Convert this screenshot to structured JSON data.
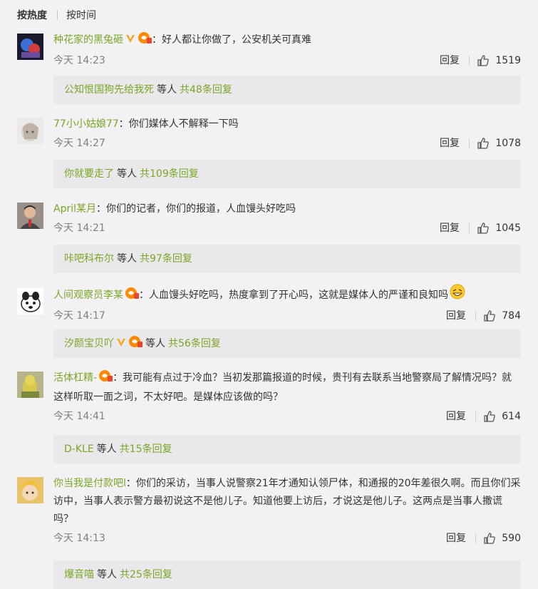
{
  "sort": {
    "active": "按热度",
    "other": "按时间"
  },
  "comments": [
    {
      "user": "种花家的黑兔砸",
      "text": "：好人都让你做了，公安机关可真难",
      "time": "今天 14:23",
      "reply_label": "回复",
      "likes": "1519",
      "sub_user": "公知恨国狗先给我死",
      "sub_etc": "等人",
      "sub_count": "共48条回复"
    },
    {
      "user": "77小小姑娘77",
      "text": "：你们媒体人不解释一下吗",
      "time": "今天 14:27",
      "reply_label": "回复",
      "likes": "1078",
      "sub_user": "你就要走了",
      "sub_etc": "等人",
      "sub_count": "共109条回复"
    },
    {
      "user": "April某月",
      "text": "：你们的记者，你们的报道，人血馒头好吃吗",
      "time": "今天 14:21",
      "reply_label": "回复",
      "likes": "1045",
      "sub_user": "咔吧科布尔",
      "sub_etc": "等人",
      "sub_count": "共97条回复"
    },
    {
      "user": "人间观察员李某",
      "text": "：人血馒头好吃吗，热度拿到了开心吗，这就是媒体人的严谨和良知吗",
      "time": "今天 14:17",
      "reply_label": "回复",
      "likes": "784",
      "sub_user": "汐颜宝贝吖",
      "sub_etc": "等人",
      "sub_count": "共56条回复"
    },
    {
      "user": "活体杠精-",
      "text": "：我可能有点过于冷血？当初发那篇报道的时候，贵刊有去联系当地警察局了解情况吗？就这样听取一面之词，不太好吧。是媒体应该做的吗？",
      "time": "今天 14:41",
      "reply_label": "回复",
      "likes": "614",
      "sub_user": "D-KLE",
      "sub_etc": "等人",
      "sub_count": "共15条回复"
    },
    {
      "user": "你当我是付款吧l",
      "text": "：你们的采访，当事人说警察21年才通知认领尸体，和通报的20年差很久啊。而且你们采访中，当事人表示警方最初说这不是他儿子。知道他要上访后，才说这是他儿子。这两点是当事人撒谎吗？",
      "time": "今天 14:13",
      "reply_label": "回复",
      "likes": "590",
      "sub_user": "爆音喵",
      "sub_etc": "等人",
      "sub_count": "共25条回复"
    }
  ]
}
